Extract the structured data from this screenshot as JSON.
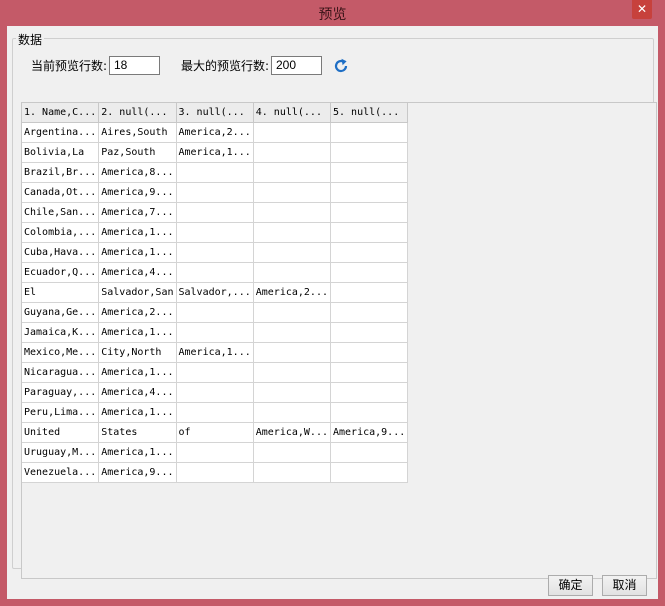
{
  "window": {
    "title": "预览",
    "close_label": "✕"
  },
  "group": {
    "legend": "数据"
  },
  "controls": {
    "current_rows_label": "当前预览行数:",
    "current_rows_value": "18",
    "max_rows_label": "最大的预览行数:",
    "max_rows_value": "200"
  },
  "table": {
    "columns": [
      "1. Name,C...",
      "2. null(...",
      "3. null(...",
      "4. null(...",
      "5. null(..."
    ],
    "rows": [
      [
        "Argentina...",
        "Aires,South",
        "America,2...",
        "",
        ""
      ],
      [
        "Bolivia,La",
        "Paz,South",
        "America,1...",
        "",
        ""
      ],
      [
        "Brazil,Br...",
        "America,8...",
        "",
        "",
        ""
      ],
      [
        "Canada,Ot...",
        "America,9...",
        "",
        "",
        ""
      ],
      [
        "Chile,San...",
        "America,7...",
        "",
        "",
        ""
      ],
      [
        "Colombia,...",
        "America,1...",
        "",
        "",
        ""
      ],
      [
        "Cuba,Hava...",
        "America,1...",
        "",
        "",
        ""
      ],
      [
        "Ecuador,Q...",
        "America,4...",
        "",
        "",
        ""
      ],
      [
        "El",
        "Salvador,San",
        "Salvador,...",
        "America,2...",
        ""
      ],
      [
        "Guyana,Ge...",
        "America,2...",
        "",
        "",
        ""
      ],
      [
        "Jamaica,K...",
        "America,1...",
        "",
        "",
        ""
      ],
      [
        "Mexico,Me...",
        "City,North",
        "America,1...",
        "",
        ""
      ],
      [
        "Nicaragua...",
        "America,1...",
        "",
        "",
        ""
      ],
      [
        "Paraguay,...",
        "America,4...",
        "",
        "",
        ""
      ],
      [
        "Peru,Lima...",
        "America,1...",
        "",
        "",
        ""
      ],
      [
        "United",
        "States",
        "of",
        "America,W...",
        "America,9..."
      ],
      [
        "Uruguay,M...",
        "America,1...",
        "",
        "",
        ""
      ],
      [
        "Venezuela...",
        "America,9...",
        "",
        "",
        ""
      ]
    ]
  },
  "buttons": {
    "ok": "确定",
    "cancel": "取消"
  },
  "colors": {
    "frame": "#c45a68",
    "refresh": "#1f6fc5"
  },
  "icons": {
    "refresh": "refresh-icon",
    "close": "close-icon"
  }
}
